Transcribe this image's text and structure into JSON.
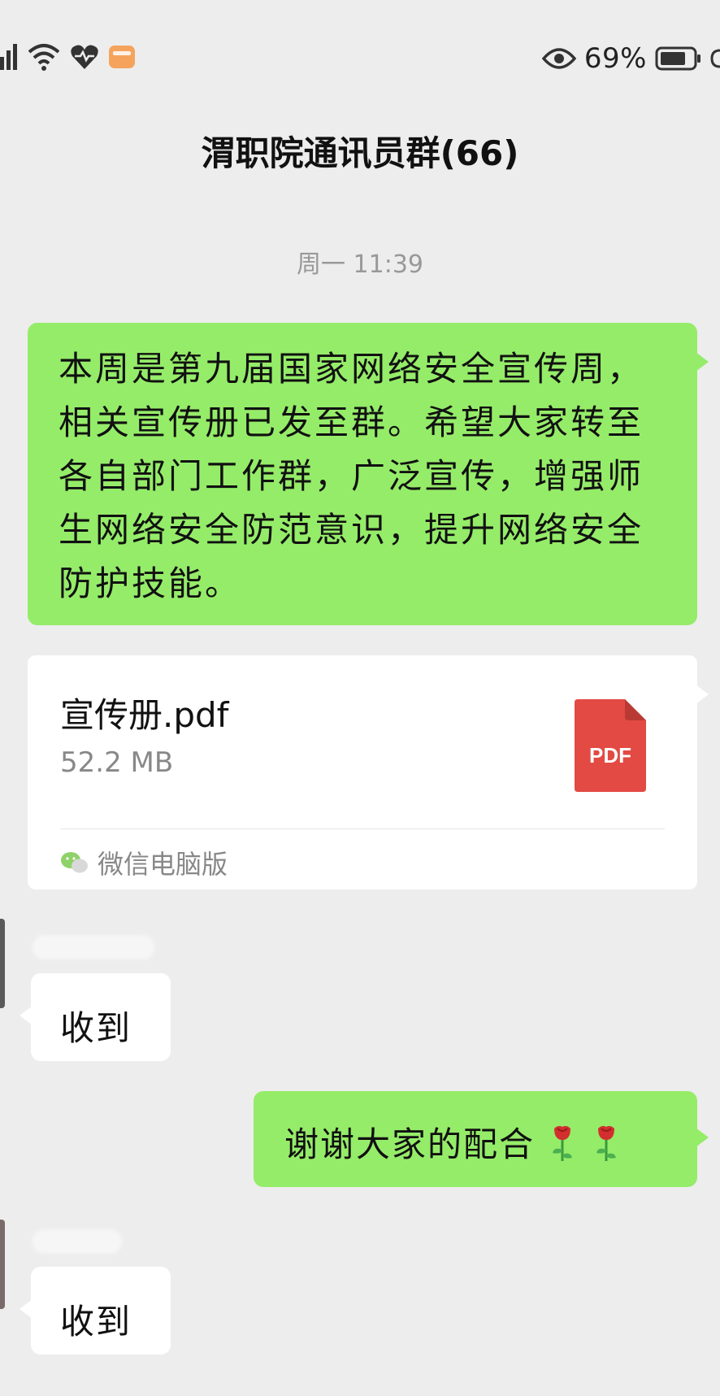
{
  "status_bar": {
    "battery_text": "69%",
    "icons": [
      "signal-icon",
      "wifi-icon",
      "heart-monitor-icon",
      "wallet-icon",
      "eye-icon",
      "battery-icon"
    ]
  },
  "header": {
    "title": "渭职院通讯员群(66)"
  },
  "timestamp": "周一 11:39",
  "messages": {
    "out_1": {
      "text": "本周是第九届国家网络安全宣传周，相关宣传册已发至群。希望大家转至各自部门工作群，广泛宣传，增强师生网络安全防范意识，提升网络安全防护技能。"
    },
    "file": {
      "name": "宣传册.pdf",
      "size": "52.2 MB",
      "type_label": "PDF",
      "source": "微信电脑版"
    },
    "in_1": {
      "text": "收到"
    },
    "out_2": {
      "text": "谢谢大家的配合"
    },
    "in_2": {
      "text": "收到"
    }
  },
  "colors": {
    "background": "#ededed",
    "outgoing_bubble": "#95ec69",
    "incoming_bubble": "#ffffff",
    "pdf_red": "#e24a43",
    "meta_text": "#888888"
  }
}
